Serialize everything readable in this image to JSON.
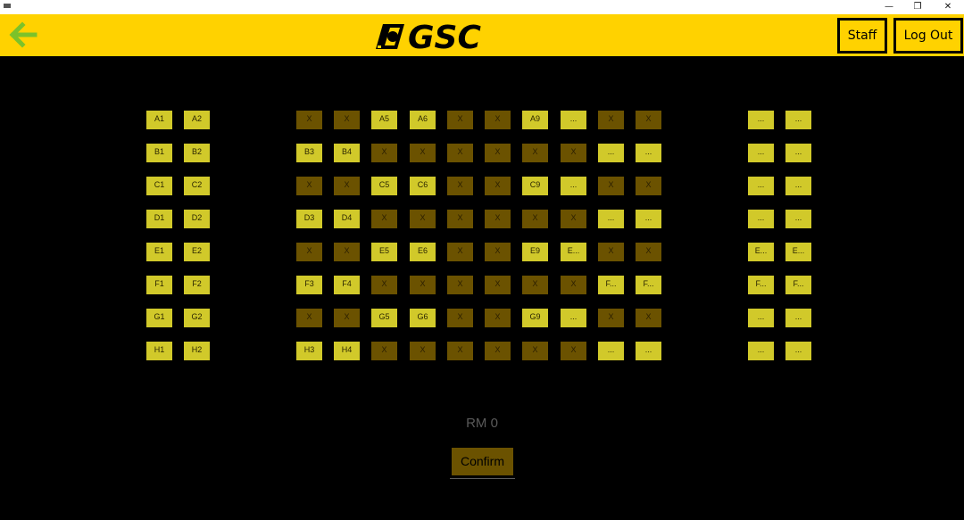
{
  "window": {
    "minimize_glyph": "—",
    "restore_glyph": "❐",
    "close_glyph": "✕"
  },
  "header": {
    "back_icon": "arrow-left-icon",
    "logo_text": "GSC",
    "staff_label": "Staff",
    "logout_label": "Log Out",
    "colors": {
      "bar": "#ffd200",
      "arrow": "#7cc22a"
    }
  },
  "seat_map": {
    "rows": [
      {
        "left": [
          "A1",
          "A2"
        ],
        "middle": [
          "X",
          "X",
          "A5",
          "A6",
          "X",
          "X",
          "A9",
          "...",
          "X",
          "X"
        ],
        "right": [
          "...",
          "..."
        ]
      },
      {
        "left": [
          "B1",
          "B2"
        ],
        "middle": [
          "B3",
          "B4",
          "X",
          "X",
          "X",
          "X",
          "X",
          "X",
          "...",
          "..."
        ],
        "right": [
          "...",
          "..."
        ]
      },
      {
        "left": [
          "C1",
          "C2"
        ],
        "middle": [
          "X",
          "X",
          "C5",
          "C6",
          "X",
          "X",
          "C9",
          "...",
          "X",
          "X"
        ],
        "right": [
          "...",
          "..."
        ]
      },
      {
        "left": [
          "D1",
          "D2"
        ],
        "middle": [
          "D3",
          "D4",
          "X",
          "X",
          "X",
          "X",
          "X",
          "X",
          "...",
          "..."
        ],
        "right": [
          "...",
          "..."
        ]
      },
      {
        "left": [
          "E1",
          "E2"
        ],
        "middle": [
          "X",
          "X",
          "E5",
          "E6",
          "X",
          "X",
          "E9",
          "E...",
          "X",
          "X"
        ],
        "right": [
          "E...",
          "E..."
        ]
      },
      {
        "left": [
          "F1",
          "F2"
        ],
        "middle": [
          "F3",
          "F4",
          "X",
          "X",
          "X",
          "X",
          "X",
          "X",
          "F...",
          "F..."
        ],
        "right": [
          "F...",
          "F..."
        ]
      },
      {
        "left": [
          "G1",
          "G2"
        ],
        "middle": [
          "X",
          "X",
          "G5",
          "G6",
          "X",
          "X",
          "G9",
          "...",
          "X",
          "X"
        ],
        "right": [
          "...",
          "..."
        ]
      },
      {
        "left": [
          "H1",
          "H2"
        ],
        "middle": [
          "H3",
          "H4",
          "X",
          "X",
          "X",
          "X",
          "X",
          "X",
          "...",
          "..."
        ],
        "right": [
          "...",
          "..."
        ]
      }
    ],
    "colors": {
      "available": "#d1c92a",
      "taken": "#6b5200"
    }
  },
  "footer": {
    "total": "RM 0",
    "confirm_label": "Confirm"
  }
}
